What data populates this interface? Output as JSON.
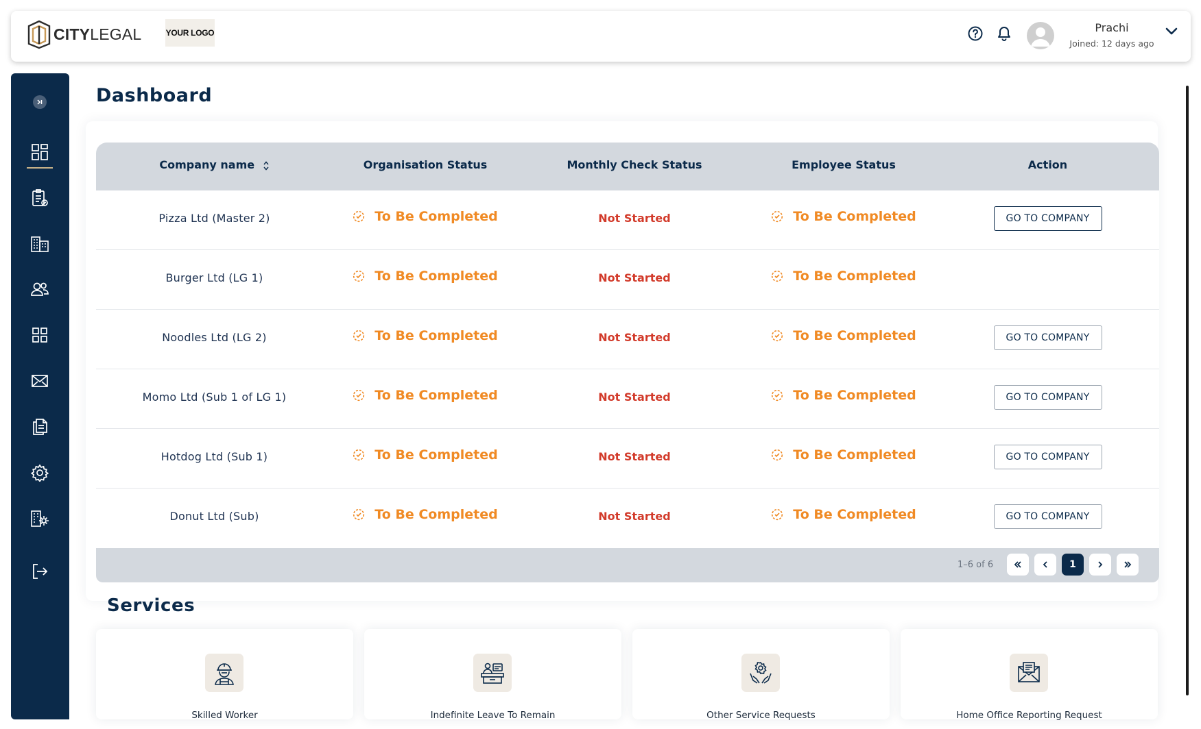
{
  "header": {
    "brand_bold": "CITY",
    "brand_light": "LEGAL",
    "your_logo": "YOUR LOGO",
    "user_name": "Prachi",
    "user_joined": "Joined: 12 days ago",
    "icons": [
      "help-icon",
      "bell-icon",
      "avatar",
      "chevron-down-icon"
    ]
  },
  "sidebar": {
    "items": [
      {
        "name": "dashboard-icon",
        "active": true
      },
      {
        "name": "checklist-icon"
      },
      {
        "name": "buildings-icon"
      },
      {
        "name": "users-icon"
      },
      {
        "name": "grid-icon"
      },
      {
        "name": "mail-icon"
      },
      {
        "name": "documents-icon"
      },
      {
        "name": "settings-icon"
      },
      {
        "name": "company-settings-icon"
      },
      {
        "name": "logout-icon"
      }
    ]
  },
  "page": {
    "title": "Dashboard"
  },
  "table": {
    "headers": {
      "company": "Company name",
      "org_status": "Organisation Status",
      "monthly_status": "Monthly Check Status",
      "employee_status": "Employee Status",
      "action": "Action"
    },
    "rows": [
      {
        "company": "Pizza Ltd (Master 2)",
        "org_status": "To Be Completed",
        "monthly_status": "Not Started",
        "employee_status": "To Be Completed",
        "action": "GO TO COMPANY"
      },
      {
        "company": "Burger Ltd (LG 1)",
        "org_status": "To Be Completed",
        "monthly_status": "Not Started",
        "employee_status": "To Be Completed",
        "action": ""
      },
      {
        "company": "Noodles Ltd (LG 2)",
        "org_status": "To Be Completed",
        "monthly_status": "Not Started",
        "employee_status": "To Be Completed",
        "action": "GO TO COMPANY"
      },
      {
        "company": "Momo Ltd (Sub 1 of LG 1)",
        "org_status": "To Be Completed",
        "monthly_status": "Not Started",
        "employee_status": "To Be Completed",
        "action": "GO TO COMPANY"
      },
      {
        "company": "Hotdog Ltd (Sub 1)",
        "org_status": "To Be Completed",
        "monthly_status": "Not Started",
        "employee_status": "To Be Completed",
        "action": "GO TO COMPANY"
      },
      {
        "company": "Donut Ltd (Sub)",
        "org_status": "To Be Completed",
        "monthly_status": "Not Started",
        "employee_status": "To Be Completed",
        "action": "GO TO COMPANY"
      }
    ],
    "pagination": {
      "range": "1–6 of 6",
      "current_page": "1"
    }
  },
  "services": {
    "title": "Services",
    "cards": [
      {
        "label": "Skilled Worker",
        "icon": "worker-icon"
      },
      {
        "label": "Indefinite Leave To Remain",
        "icon": "desk-icon"
      },
      {
        "label": "Other Service Requests",
        "icon": "hands-gear-icon"
      },
      {
        "label": "Home Office Reporting Request",
        "icon": "report-mail-icon"
      }
    ]
  },
  "colors": {
    "navy": "#0b2a4a",
    "orange_status": "#f08a24",
    "red_status": "#d23a2a",
    "table_header_bg": "#d3d8de"
  }
}
